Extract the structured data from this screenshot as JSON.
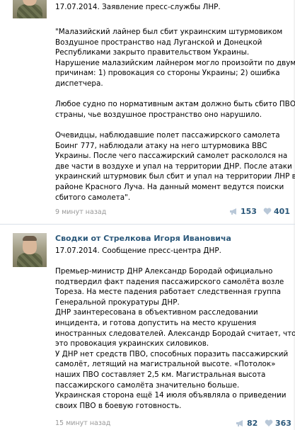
{
  "posts": [
    {
      "author": "",
      "header": "17.07.2014. Заявление пресс-службы ЛНР.",
      "body": [
        "\"Малазийский лайнер был сбит украинским штурмовиком",
        "Воздушное пространство над Луганской и Донецкой",
        "Республиками закрыто правительством Украины.",
        "Нарушение малазийским лайнером могло произойти по двум",
        "причинам: 1) провокация со стороны Украины; 2) ошибка",
        "диспетчера.",
        "",
        "Любое судно по нормативным актам должно быть сбито ПВО",
        "страны, чье воздушное пространство оно нарушило.",
        "",
        "Очевидцы, наблюдавшие полет пассажирского самолета",
        "Боинг 777, наблюдали атаку на него штурмовика ВВС",
        "Украины. После чего пассажирский самолет раскололся на",
        "две части в воздухе и упал на территории ДНР. После атаки",
        "украинский штурмовик был сбит и упал на территории ЛНР в",
        "районе Красного Луча. На данный момент ведутся поиски",
        "сбитого самолета\"."
      ],
      "time": "9 минут назад",
      "reposts": "153",
      "likes": "401"
    },
    {
      "author": "Сводки от Стрелкова Игоря Ивановича",
      "header": "17.07.2014. Сообщение пресс-центра ДНР.",
      "body": [
        "Премьер-министр ДНР Александр Бородай официально",
        "подтвердил факт падения пассажирского самолёта возле",
        "Тореза. На месте падения работает следственная группа",
        "Генеральной прокуратуры ДНР.",
        "ДНР заинтересована в объективном расследовании",
        "инцидента, и готова допустить на место крушения",
        "иностранных следователей. Александр Бородай считает, что",
        "это провокация украинских силовиков.",
        "У ДНР нет средств ПВО, способных поразить пассажирский",
        "самолёт, летящий на магистральной высоте. «Потолок»",
        "наших ПВО составляет 2,5 км. Магистральная высота",
        "пассажирского самолёта значительно больше.",
        "Украинская сторона ещё 14 июля объявляла о приведении",
        "своих ПВО в боевую готовность."
      ],
      "time": "15 минут назад",
      "reposts": "82",
      "likes": "363"
    }
  ],
  "icons": {
    "repost": "megaphone-icon",
    "like": "heart-icon"
  },
  "colors": {
    "link": "#2b587a",
    "meta": "#999999",
    "divider": "#dae1e8"
  }
}
